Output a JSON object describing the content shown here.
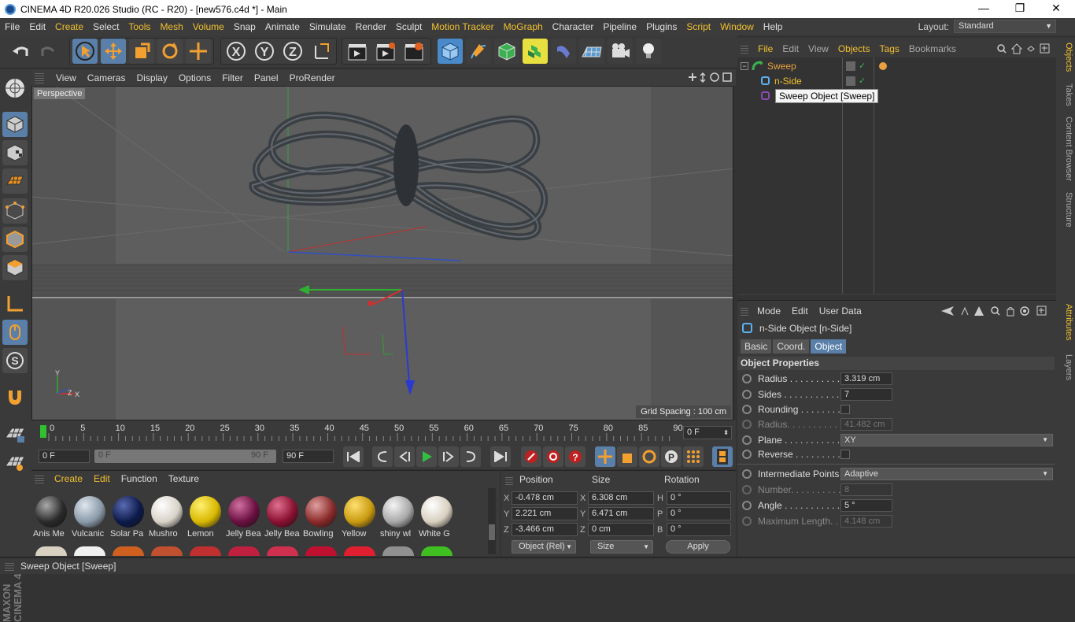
{
  "title": "CINEMA 4D R20.026 Studio (RC - R20) - [new576.c4d *] - Main",
  "window_controls": {
    "minimize": "—",
    "restore": "❐",
    "close": "✕"
  },
  "menubar": [
    "File",
    "Edit",
    "Create",
    "Select",
    "Tools",
    "Mesh",
    "Volume",
    "Snap",
    "Animate",
    "Simulate",
    "Render",
    "Sculpt",
    "Motion Tracker",
    "MoGraph",
    "Character",
    "Pipeline",
    "Plugins",
    "Script",
    "Window",
    "Help"
  ],
  "layout": {
    "label": "Layout:",
    "value": "Standard"
  },
  "viewport": {
    "menu": [
      "View",
      "Cameras",
      "Display",
      "Options",
      "Filter",
      "Panel",
      "ProRender"
    ],
    "label": "Perspective",
    "grid_spacing": "Grid Spacing : 100 cm",
    "axis_y": "Y",
    "axis_z": "Z",
    "axis_x": "X"
  },
  "timeline": {
    "ticks": [
      "0",
      "5",
      "10",
      "15",
      "20",
      "25",
      "30",
      "35",
      "40",
      "45",
      "50",
      "55",
      "60",
      "65",
      "70",
      "75",
      "80",
      "85",
      "90"
    ],
    "current_frame": "0 F"
  },
  "playbar": {
    "start": "0 F",
    "range_start": "0 F",
    "range_end": "90 F",
    "end": "90 F"
  },
  "materials": {
    "menu": [
      "Create",
      "Edit",
      "Function",
      "Texture"
    ],
    "items": [
      {
        "name": "Anis Me",
        "color": "#2a2a2a",
        "hi": "#aaaaaa"
      },
      {
        "name": "Vulcanic",
        "color": "#8a9aa8",
        "hi": "#dfe6ee"
      },
      {
        "name": "Solar Pa",
        "color": "#0c1a4a",
        "hi": "#5a6ab0"
      },
      {
        "name": "Mushro",
        "color": "#d8d2c8",
        "hi": "#ffffff"
      },
      {
        "name": "Lemon",
        "color": "#d8b800",
        "hi": "#fff070"
      },
      {
        "name": "Jelly Bea",
        "color": "#6a1040",
        "hi": "#d070a0"
      },
      {
        "name": "Jelly Bea",
        "color": "#8a1030",
        "hi": "#e07090"
      },
      {
        "name": "Bowling",
        "color": "#8a2a2a",
        "hi": "#e0a0a0"
      },
      {
        "name": "Yellow",
        "color": "#c89a10",
        "hi": "#ffe070"
      },
      {
        "name": "shiny wl",
        "color": "#a8a8a8",
        "hi": "#f4f4f4"
      },
      {
        "name": "White G",
        "color": "#d8d0c0",
        "hi": "#ffffff"
      }
    ]
  },
  "coords": {
    "headers": [
      "Position",
      "Size",
      "Rotation"
    ],
    "rows": [
      {
        "axis": "X",
        "pos": "-0.478 cm",
        "size_axis": "X",
        "size": "6.308 cm",
        "rot_axis": "H",
        "rot": "0 °"
      },
      {
        "axis": "Y",
        "pos": "2.221 cm",
        "size_axis": "Y",
        "size": "6.471 cm",
        "rot_axis": "P",
        "rot": "0 °"
      },
      {
        "axis": "Z",
        "pos": "-3.466 cm",
        "size_axis": "Z",
        "size": "0 cm",
        "rot_axis": "B",
        "rot": "0 °"
      }
    ],
    "mode": "Object (Rel)",
    "size_mode": "Size",
    "apply": "Apply"
  },
  "objects": {
    "menu": [
      "File",
      "Edit",
      "View",
      "Objects",
      "Tags",
      "Bookmarks"
    ],
    "items": [
      {
        "name": "Sweep",
        "color": "#e8a040"
      },
      {
        "name": "n-Side",
        "color": "#f2c12e"
      }
    ],
    "tooltip": "Sweep Object [Sweep]"
  },
  "right_tabs": [
    "Objects",
    "Takes",
    "Content Browser",
    "Structure",
    "Attributes",
    "Layers"
  ],
  "attributes": {
    "menu": [
      "Mode",
      "Edit",
      "User Data"
    ],
    "title": "n-Side Object [n-Side]",
    "tabs": [
      "Basic",
      "Coord.",
      "Object"
    ],
    "section": "Object Properties",
    "rows": [
      {
        "label": "Radius . . . . . . . . . .",
        "value": "3.319 cm"
      },
      {
        "label": "Sides . . . . . . . . . . . .",
        "value": "7"
      },
      {
        "label": "Rounding . . . . . . . .",
        "value": ""
      },
      {
        "label": "Radius. . . . . . . . . . .",
        "value": "41.482 cm"
      },
      {
        "label": "Plane . . . . . . . . . . . .",
        "value": "XY"
      },
      {
        "label": "Reverse . . . . . . . . . .",
        "value": ""
      },
      {
        "label": "Intermediate Points",
        "value": "Adaptive"
      },
      {
        "label": "Number. . . . . . . . . .",
        "value": "8"
      },
      {
        "label": "Angle . . . . . . . . . . .",
        "value": "5 °"
      },
      {
        "label": "Maximum Length. .",
        "value": "4.148 cm"
      }
    ]
  },
  "status": "Sweep Object [Sweep]"
}
